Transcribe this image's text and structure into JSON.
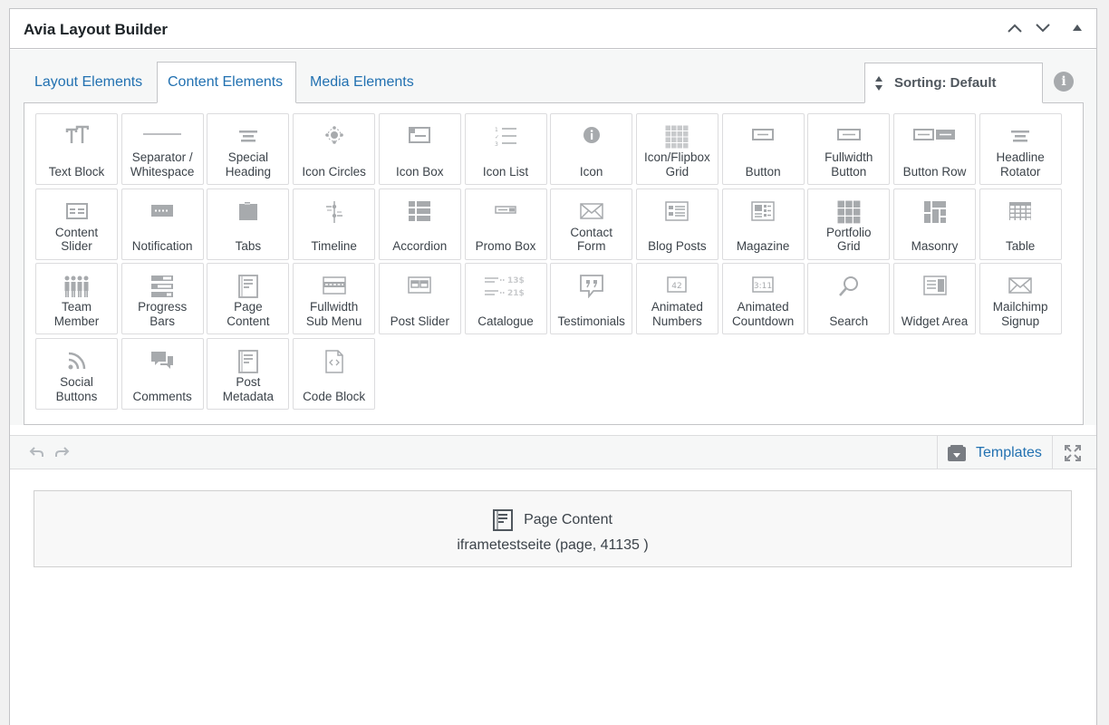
{
  "panel": {
    "title": "Avia Layout Builder"
  },
  "tabs": [
    {
      "label": "Layout Elements"
    },
    {
      "label": "Content Elements"
    },
    {
      "label": "Media Elements"
    }
  ],
  "sorting": {
    "label": "Sorting: Default"
  },
  "info_glyph": "i",
  "elements": [
    {
      "label": "Text Block",
      "icon": "text-block-icon"
    },
    {
      "label": "Separator /\nWhitespace",
      "icon": "separator-icon"
    },
    {
      "label": "Special\nHeading",
      "icon": "special-heading-icon"
    },
    {
      "label": "Icon Circles",
      "icon": "icon-circles-icon"
    },
    {
      "label": "Icon Box",
      "icon": "icon-box-icon"
    },
    {
      "label": "Icon List",
      "icon": "icon-list-icon"
    },
    {
      "label": "Icon",
      "icon": "info-circle-icon"
    },
    {
      "label": "Icon/Flipbox\nGrid",
      "icon": "flipbox-grid-icon"
    },
    {
      "label": "Button",
      "icon": "button-icon"
    },
    {
      "label": "Fullwidth\nButton",
      "icon": "fullwidth-button-icon"
    },
    {
      "label": "Button Row",
      "icon": "button-row-icon"
    },
    {
      "label": "Headline\nRotator",
      "icon": "headline-rotator-icon"
    },
    {
      "label": "Content\nSlider",
      "icon": "content-slider-icon"
    },
    {
      "label": "Notification",
      "icon": "notification-icon"
    },
    {
      "label": "Tabs",
      "icon": "tabs-icon"
    },
    {
      "label": "Timeline",
      "icon": "timeline-icon"
    },
    {
      "label": "Accordion",
      "icon": "accordion-icon"
    },
    {
      "label": "Promo Box",
      "icon": "promo-box-icon"
    },
    {
      "label": "Contact\nForm",
      "icon": "envelope-icon"
    },
    {
      "label": "Blog Posts",
      "icon": "blog-posts-icon"
    },
    {
      "label": "Magazine",
      "icon": "magazine-icon"
    },
    {
      "label": "Portfolio\nGrid",
      "icon": "portfolio-grid-icon"
    },
    {
      "label": "Masonry",
      "icon": "masonry-icon"
    },
    {
      "label": "Table",
      "icon": "table-icon"
    },
    {
      "label": "Team\nMember",
      "icon": "team-member-icon"
    },
    {
      "label": "Progress\nBars",
      "icon": "progress-bars-icon"
    },
    {
      "label": "Page\nContent",
      "icon": "page-content-icon"
    },
    {
      "label": "Fullwidth\nSub Menu",
      "icon": "sub-menu-icon"
    },
    {
      "label": "Post Slider",
      "icon": "post-slider-icon"
    },
    {
      "label": "Catalogue",
      "icon": "catalogue-icon",
      "price_1": "13$",
      "price_2": "21$"
    },
    {
      "label": "Testimonials",
      "icon": "testimonials-icon"
    },
    {
      "label": "Animated\nNumbers",
      "icon": "animated-numbers-icon",
      "value": "42"
    },
    {
      "label": "Animated\nCountdown",
      "icon": "animated-countdown-icon",
      "value": "3:11"
    },
    {
      "label": "Search",
      "icon": "search-icon"
    },
    {
      "label": "Widget Area",
      "icon": "widget-area-icon"
    },
    {
      "label": "Mailchimp\nSignup",
      "icon": "envelope-icon"
    },
    {
      "label": "Social\nButtons",
      "icon": "social-buttons-icon"
    },
    {
      "label": "Comments",
      "icon": "comments-icon"
    },
    {
      "label": "Post\nMetadata",
      "icon": "post-metadata-icon"
    },
    {
      "label": "Code Block",
      "icon": "code-block-icon"
    }
  ],
  "toolbar": {
    "templates_label": "Templates"
  },
  "canvas": {
    "block_title": "Page Content",
    "block_subtitle": "iframetestseite (page, 41135 )"
  },
  "colors": {
    "link": "#2271b1",
    "icon_gray": "#a7aaad",
    "border": "#c3c4c7"
  }
}
